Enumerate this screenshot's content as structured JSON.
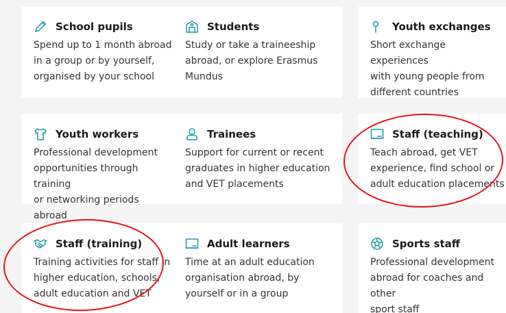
{
  "cards": [
    {
      "icon": "pencil-icon",
      "title": "School pupils",
      "description": "Spend up to 1 month abroad\nin a group or by yourself,\norganised by your school"
    },
    {
      "icon": "school-building-icon",
      "title": "Students",
      "description": "Study or take a traineeship\nabroad, or explore Erasmus\nMundus"
    },
    {
      "icon": "location-pin-icon",
      "title": "Youth exchanges",
      "description": "Short exchange experiences\nwith young people from\ndifferent countries"
    },
    {
      "icon": "shirt-icon",
      "title": "Youth workers",
      "description": "Professional development\nopportunities through training\nor networking periods abroad"
    },
    {
      "icon": "person-icon",
      "title": "Trainees",
      "description": "Support for current or recent\ngraduates in higher education\nand VET placements"
    },
    {
      "icon": "blackboard-icon",
      "title": "Staff (teaching)",
      "description": "Teach abroad, get VET\nexperience, find school or\nadult education placements"
    },
    {
      "icon": "handshake-icon",
      "title": "Staff (training)",
      "description": "Training activities for staff in\nhigher education, schools,\nadult education and VET"
    },
    {
      "icon": "blackboard-icon",
      "title": "Adult learners",
      "description": "Time at an adult education\norganisation abroad, by\nyourself or in a group"
    },
    {
      "icon": "ball-icon",
      "title": "Sports staff",
      "description": "Professional development\nabroad for coaches and other\nsport staff"
    }
  ],
  "colors": {
    "icon": "#1a9aa3",
    "highlight": "#e8101a",
    "card_background": "#ffffff",
    "page_background": "#f5f5f5"
  }
}
